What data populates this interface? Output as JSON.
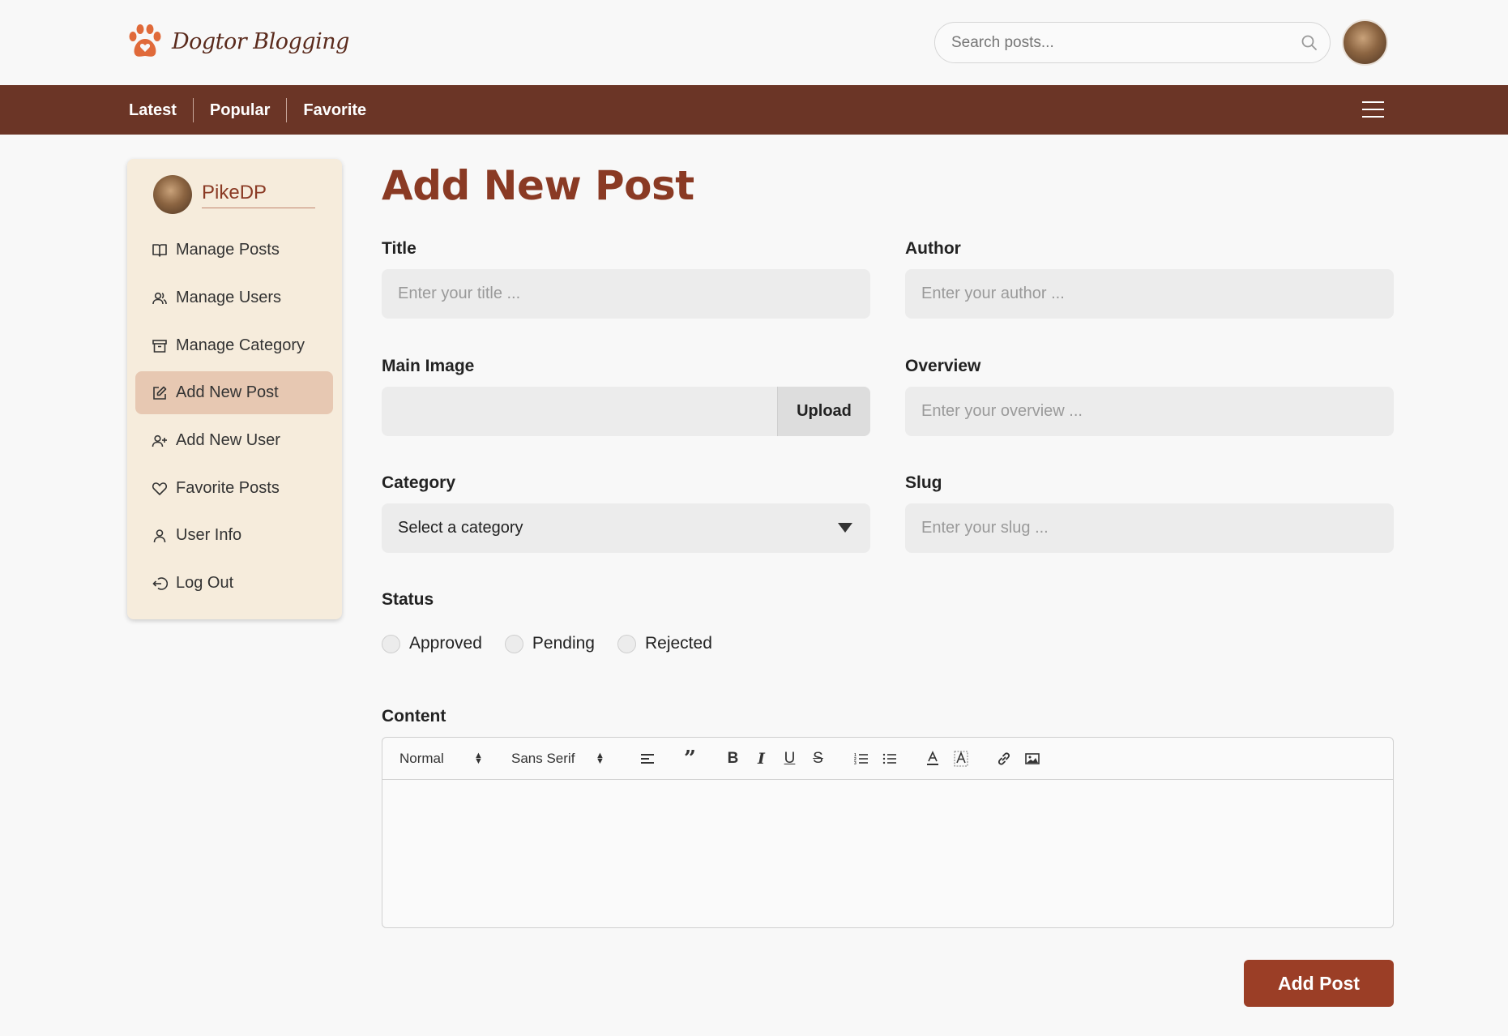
{
  "header": {
    "logo_text": "Dogtor Blogging",
    "search_placeholder": "Search posts...",
    "brand_color": "#6b3526"
  },
  "nav": {
    "links": [
      "Latest",
      "Popular",
      "Favorite"
    ]
  },
  "sidebar": {
    "username": "PikeDP",
    "items": [
      {
        "label": "Manage Posts",
        "icon": "book-icon"
      },
      {
        "label": "Manage Users",
        "icon": "users-icon"
      },
      {
        "label": "Manage Category",
        "icon": "archive-icon"
      },
      {
        "label": "Add New Post",
        "icon": "edit-icon",
        "active": true
      },
      {
        "label": "Add New User",
        "icon": "user-plus-icon"
      },
      {
        "label": "Favorite Posts",
        "icon": "heart-icon"
      },
      {
        "label": "User Info",
        "icon": "user-icon"
      },
      {
        "label": "Log Out",
        "icon": "logout-icon"
      }
    ]
  },
  "form": {
    "title": "Add New Post",
    "fields": {
      "title": {
        "label": "Title",
        "placeholder": "Enter your title ..."
      },
      "author": {
        "label": "Author",
        "placeholder": "Enter your author ..."
      },
      "main_image": {
        "label": "Main Image",
        "button": "Upload"
      },
      "overview": {
        "label": "Overview",
        "placeholder": "Enter your overview ..."
      },
      "category": {
        "label": "Category",
        "selected": "Select a category"
      },
      "slug": {
        "label": "Slug",
        "placeholder": "Enter your slug ..."
      }
    },
    "status": {
      "label": "Status",
      "options": [
        "Approved",
        "Pending",
        "Rejected"
      ]
    },
    "content": {
      "label": "Content",
      "heading_select": "Normal",
      "font_select": "Sans Serif"
    },
    "submit": "Add Post"
  }
}
